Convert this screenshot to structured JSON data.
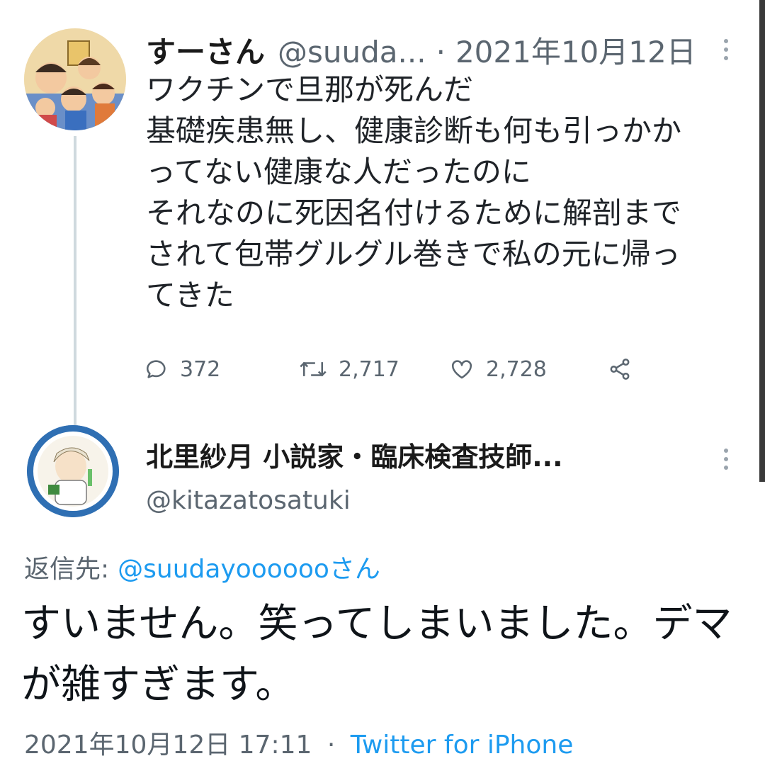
{
  "original_tweet": {
    "display_name": "すーさん",
    "handle": "@suuda...",
    "separator": "·",
    "date": "2021年10月12日",
    "text_lines": [
      "ワクチンで旦那が死んだ",
      "基礎疾患無し、健康診断も何も引っかか",
      "ってない健康な人だったのに",
      "それなのに死因名付けるために解剖まで",
      "されて包帯グルグル巻きで私の元に帰っ",
      "てきた"
    ],
    "replies": "372",
    "retweets": "2,717",
    "likes": "2,728"
  },
  "reply_tweet": {
    "display_name": "北里紗月 小説家・臨床検査技師...",
    "handle": "@kitazatosatuki",
    "replying_to_label": "返信先:",
    "replying_to_mention": "@suudayoooooo",
    "replying_to_suffix": "さん",
    "text": "すいません。笑ってしまいました。デマが雑すぎます。",
    "timestamp": "2021年10月12日 17:11",
    "separator": "·",
    "source": "Twitter for iPhone"
  },
  "icons": {
    "reply": "reply-icon",
    "retweet": "retweet-icon",
    "like": "heart-icon",
    "share": "share-icon",
    "more": "more-options-icon"
  },
  "colors": {
    "link": "#1d9bf0",
    "secondary_text": "#5b6670",
    "thread_line": "#cfd9de"
  }
}
